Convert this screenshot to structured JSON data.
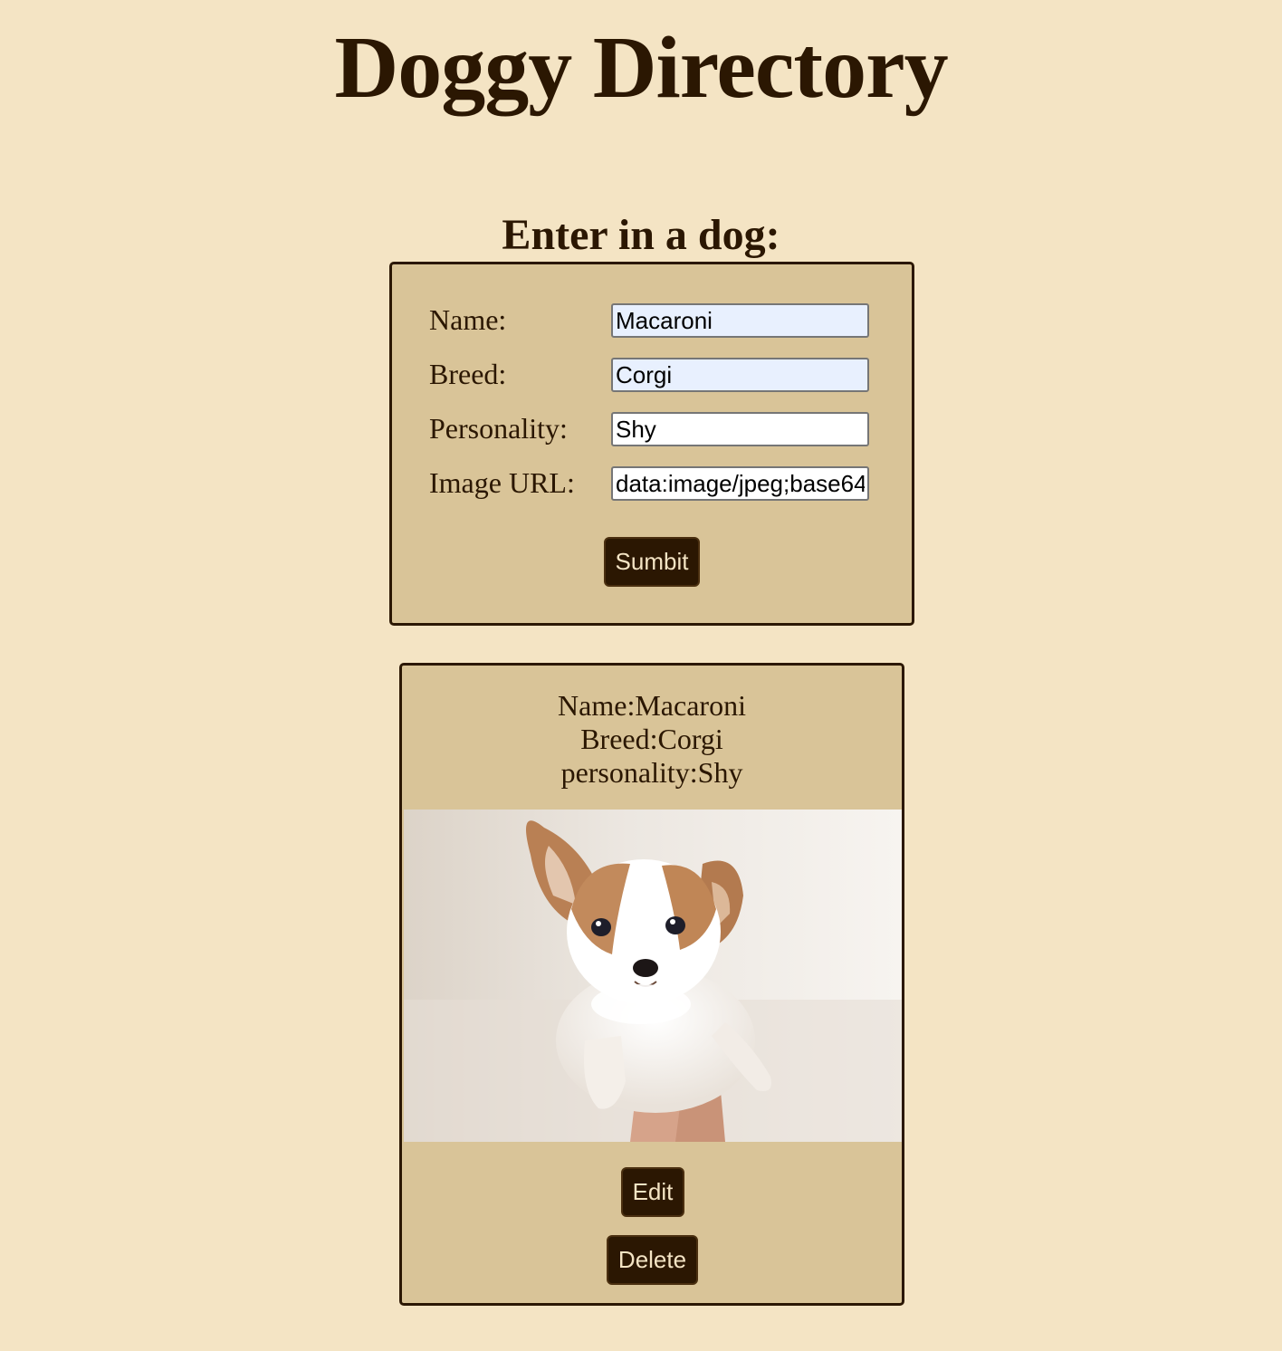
{
  "page": {
    "title": "Doggy Directory"
  },
  "form": {
    "heading": "Enter in a dog:",
    "fields": [
      {
        "label": "Name:",
        "value": "Macaroni"
      },
      {
        "label": "Breed:",
        "value": "Corgi"
      },
      {
        "label": "Personality:",
        "value": "Shy"
      },
      {
        "label": "Image URL:",
        "value": "data:image/jpeg;base64"
      }
    ],
    "submit_label": "Sumbit"
  },
  "dog_card": {
    "name_line": "Name:Macaroni",
    "breed_line": "Breed:Corgi",
    "personality_line": "personality:Shy",
    "photo_alt": "corgi puppy",
    "edit_label": "Edit",
    "delete_label": "Delete"
  }
}
